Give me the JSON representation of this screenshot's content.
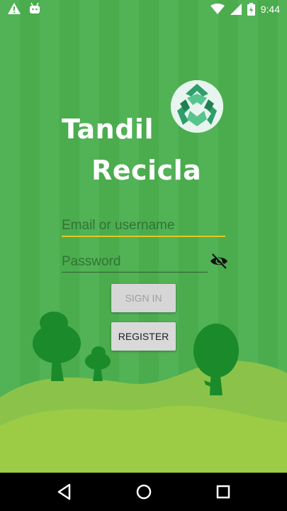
{
  "status_bar": {
    "time": "9:44",
    "left_icons": [
      "warning-icon",
      "android-icon"
    ],
    "right_icons": [
      "wifi-icon",
      "signal-icon",
      "battery-icon"
    ]
  },
  "app": {
    "title_line1": "Tandil",
    "title_line2": "Recicla",
    "logo_icon": "recycle-globe-icon"
  },
  "form": {
    "email_placeholder": "Email or username",
    "email_value": "",
    "password_placeholder": "Password",
    "password_value": "",
    "password_toggle_icon": "eye-off-icon",
    "signin_label": "SIGN IN",
    "register_label": "REGISTER"
  },
  "nav_bar": {
    "icons": [
      "back-icon",
      "home-icon",
      "recents-icon"
    ]
  },
  "colors": {
    "background": "#4caf50",
    "hills_front": "#8bc34a",
    "trees": "#1b8a2a",
    "accent_underline": "#e6c81a"
  }
}
